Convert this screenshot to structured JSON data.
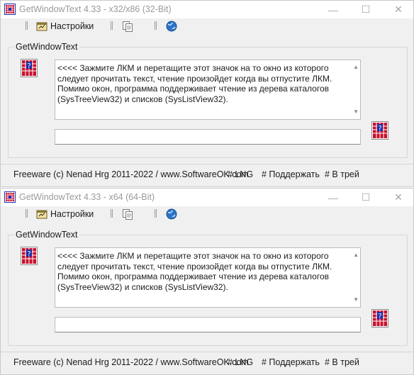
{
  "windows": [
    {
      "title": "GetWindowText 4.33 - x32/x86 (32-Bit)",
      "toolbar": {
        "settings_label": "Настройки"
      },
      "group_title": "GetWindowText",
      "info_text": "<<<< Зажмите ЛКМ и перетащите этот значок на то окно из которого следует прочитать текст, чтение произойдет когда вы отпустите ЛКМ. Помимо окон, программа поддерживает чтение из дерева каталогов (SysTreeView32) и списков (SysListView32).",
      "result_value": "",
      "status": {
        "copyright": "Freeware (c) Nenad Hrg 2011-2022 / www.SoftwareOK.com",
        "lng": "# LNG",
        "support": "# Поддержать",
        "tray": "# В трей"
      }
    },
    {
      "title": "GetWindowText 4.33 - x64 (64-Bit)",
      "toolbar": {
        "settings_label": "Настройки"
      },
      "group_title": "GetWindowText",
      "info_text": "<<<< Зажмите ЛКМ и перетащите этот значок на то окно из которого следует прочитать текст, чтение произойдет когда вы отпустите ЛКМ. Помимо окон, программа поддерживает чтение из дерева каталогов (SysTreeView32) и списков (SysListView32).",
      "result_value": "",
      "status": {
        "copyright": "Freeware (c) Nenad Hrg 2011-2022 / www.SoftwareOK.com",
        "lng": "# LNG",
        "support": "# Поддержать",
        "tray": "# В трей"
      }
    }
  ],
  "caption_buttons": {
    "minimize": "—",
    "maximize": "☐",
    "close": "✕"
  },
  "icons": [
    "app-icon",
    "settings-icon",
    "copy-icon",
    "globe-icon",
    "drag-finder-icon",
    "scroll-up-arrow-icon",
    "scroll-down-arrow-icon"
  ],
  "colors": {
    "icon_red": "#c8102e",
    "icon_blue": "#1e2fa8",
    "globe_blue": "#2b73c7"
  }
}
